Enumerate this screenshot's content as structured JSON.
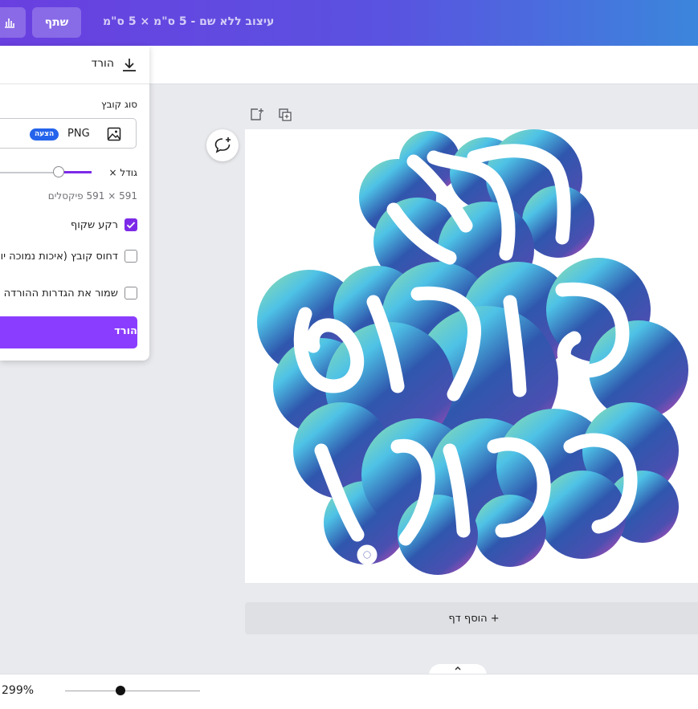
{
  "topbar": {
    "title": "עיצוב ללא שם - 5 ס\"מ × 5 ס\"מ",
    "share_label": "שתף",
    "stats_icon": "bar-chart-icon"
  },
  "download_panel": {
    "title": "הורד",
    "title_icon": "download-icon",
    "file_type_label": "סוג קובץ",
    "file_type_value": "PNG",
    "file_type_badge": "הצעה",
    "file_type_icon": "image-icon",
    "size_label": "גודל ×",
    "size_slider_level": 0.35,
    "dimensions_text": "591 × 591 פיקסלים",
    "options": [
      {
        "label": "רקע שקוף",
        "checked": true
      },
      {
        "label": "דחוס קובץ (איכות נמוכה יותר)",
        "checked": false
      },
      {
        "label": "שמור את הגדרות ההורדה",
        "checked": false
      }
    ],
    "download_button_label": "הורד"
  },
  "canvas": {
    "sticker_text_lines": [
      "חג",
      "פורים",
      "שמח!"
    ],
    "colors": {
      "teal": "#7fd3b8",
      "blue": "#2f57ad",
      "indigo": "#3c4fb0",
      "magenta": "#c94cb8"
    }
  },
  "page_tools": {
    "add_icon": "add-page-icon",
    "duplicate_icon": "duplicate-icon",
    "comment_icon": "add-comment-icon"
  },
  "add_page_label": "+ הוסף דף",
  "bottombar": {
    "zoom_text": "299%",
    "zoom_level": 0.41,
    "collapse_icon": "chevron-up-icon"
  }
}
